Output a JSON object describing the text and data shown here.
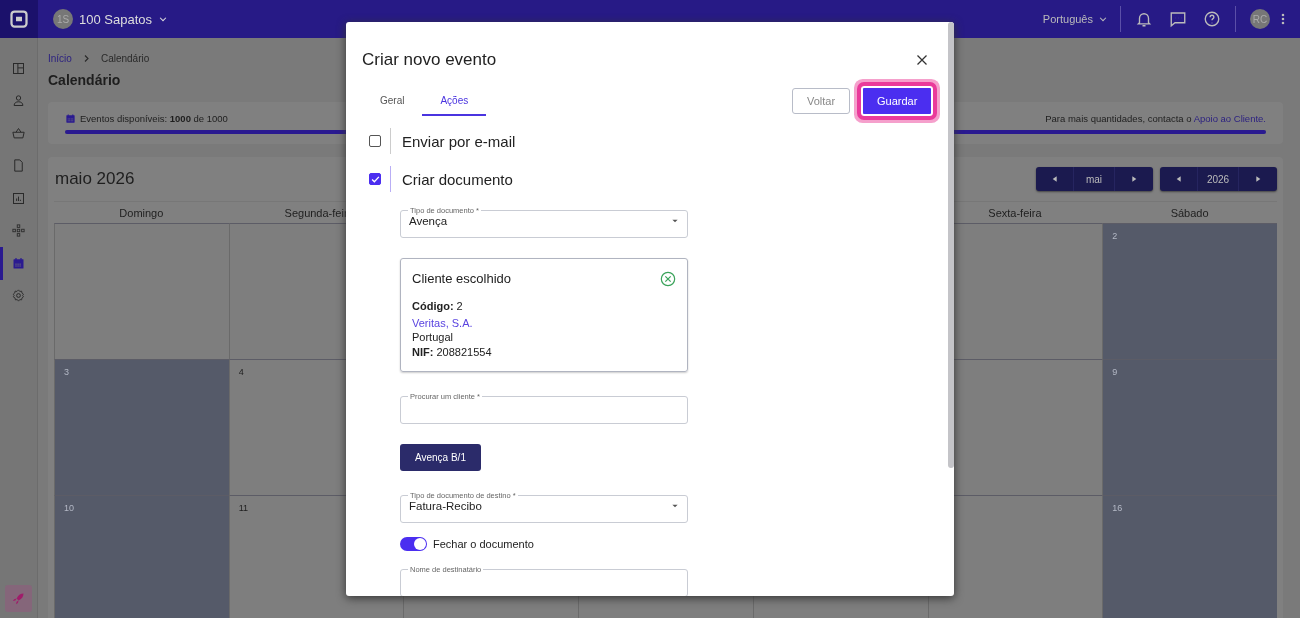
{
  "topbar": {
    "company_initials": "1S",
    "company": "100 Sapatos",
    "language": "Português",
    "user_initials": "RC"
  },
  "sidebar": {
    "items": [
      {
        "kind": "layout",
        "selected": false
      },
      {
        "kind": "person",
        "selected": false
      },
      {
        "kind": "basket",
        "selected": false
      },
      {
        "kind": "document",
        "selected": false
      },
      {
        "kind": "chart",
        "selected": false
      },
      {
        "kind": "nodes",
        "selected": false
      },
      {
        "kind": "calendar",
        "selected": true
      },
      {
        "kind": "gear",
        "selected": false
      }
    ]
  },
  "breadcrumb": [
    {
      "label": "Início",
      "link": true
    },
    {
      "label": "Calendário",
      "link": false
    }
  ],
  "page_title": "Calendário",
  "quota": {
    "text": "Eventos disponíveis: **1000** de 1000",
    "level": 1,
    "note": "Para mais quantidades, contacta o",
    "link": "Apoio ao Cliente."
  },
  "calendar": {
    "title": "maio 2026",
    "month": "mai",
    "year": "2026",
    "weekdays_left": [
      "Domingo",
      "Segunda-feir"
    ],
    "weekdays_right": [
      "Sexta-feira",
      "Sábado"
    ],
    "weeks": [
      {
        "left": [
          {
            "shaded": false
          },
          {
            "shaded": false
          }
        ],
        "right": [
          {
            "shaded": false
          },
          {
            "day": "2",
            "shaded": true
          }
        ]
      },
      {
        "left": [
          {
            "day": "3",
            "shaded": true
          },
          {
            "day": "4",
            "shaded": false
          }
        ],
        "right": [
          {
            "shaded": false
          },
          {
            "day": "9",
            "shaded": true
          }
        ]
      },
      {
        "left": [
          {
            "day": "10",
            "shaded": true
          },
          {
            "day": "11",
            "shaded": false
          }
        ],
        "right": [
          {
            "shaded": false
          },
          {
            "day": "16",
            "shaded": true
          }
        ]
      }
    ]
  },
  "modal": {
    "title": "Criar novo evento",
    "tabs": [
      {
        "label": "Geral",
        "selected": false
      },
      {
        "label": "Ações",
        "selected": true
      }
    ],
    "buttons": [
      {
        "label": "Voltar",
        "kind": "secondary",
        "focused": false
      },
      {
        "label": "Guardar",
        "kind": "primary",
        "focused": true
      }
    ],
    "actions": [
      {
        "label": "Enviar por e-mail",
        "checked": false
      },
      {
        "label": "Criar documento",
        "checked": true
      }
    ],
    "fields": [
      {
        "kind": "select",
        "label": "Tipo de documento *",
        "value": "Avença"
      },
      {
        "kind": "client",
        "title": "Cliente escolhido",
        "code": "**Código:** 2",
        "name": "Veritas, S.A.",
        "country": "Portugal",
        "nif": "**NIF:** 208821554"
      },
      {
        "kind": "input",
        "label": "Procurar um cliente *"
      },
      {
        "kind": "button",
        "label": "Avença B/1"
      },
      {
        "kind": "select",
        "label": "Tipo de documento de destino *",
        "value": "Fatura-Recibo"
      },
      {
        "kind": "toggle",
        "label": "Fechar o documento",
        "on": true
      },
      {
        "kind": "input",
        "label": "Nome de destinatário"
      }
    ]
  }
}
